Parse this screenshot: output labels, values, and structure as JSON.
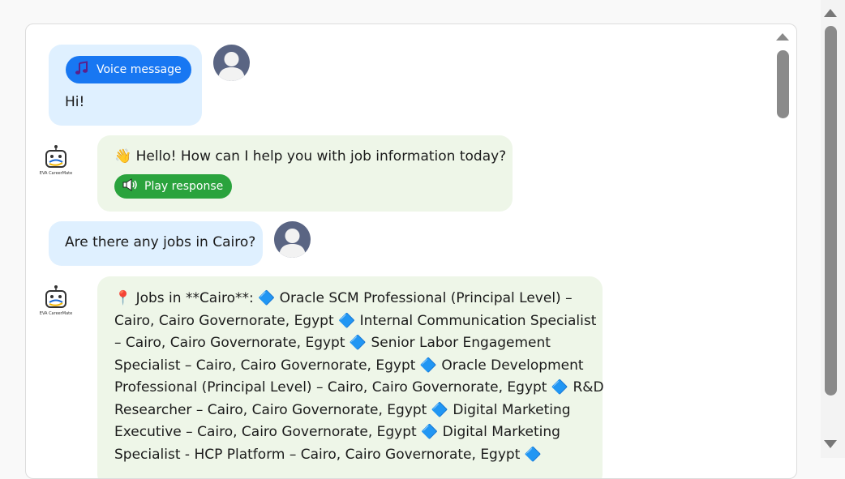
{
  "messages": {
    "user_voice": {
      "voice_label": "Voice message",
      "text": "Hi!"
    },
    "bot_greeting": {
      "text": "👋 Hello! How can I help you with job information today?",
      "play_label": "Play response"
    },
    "user_question": {
      "text": "Are there any jobs in Cairo?"
    },
    "bot_jobs": {
      "lines": [
        "📍 Jobs in **Cairo**: 🔷 Oracle SCM Professional (Principal Level) –",
        "Cairo, Cairo Governorate, Egypt 🔷 Internal Communication Specialist",
        "– Cairo, Cairo Governorate, Egypt 🔷 Senior Labor Engagement",
        "Specialist – Cairo, Cairo Governorate, Egypt 🔷 Oracle Development",
        "Professional (Principal Level) – Cairo, Cairo Governorate, Egypt 🔷 R&D",
        "Researcher – Cairo, Cairo Governorate, Egypt 🔷 Digital Marketing",
        "Executive – Cairo, Cairo Governorate, Egypt 🔷 Digital Marketing",
        "Specialist - HCP Platform – Cairo, Cairo Governorate, Egypt 🔷"
      ]
    }
  },
  "bot": {
    "logo_label": "EVA CareerMate"
  },
  "colors": {
    "user_bubble": "#dff0ff",
    "bot_bubble": "#eef6e8",
    "voice_badge": "#1877f2",
    "play_badge": "#2aa33d"
  },
  "icons": {
    "voice": "music-note-icon",
    "play": "speaker-icon",
    "user": "user-avatar-icon",
    "bot": "robot-icon"
  }
}
